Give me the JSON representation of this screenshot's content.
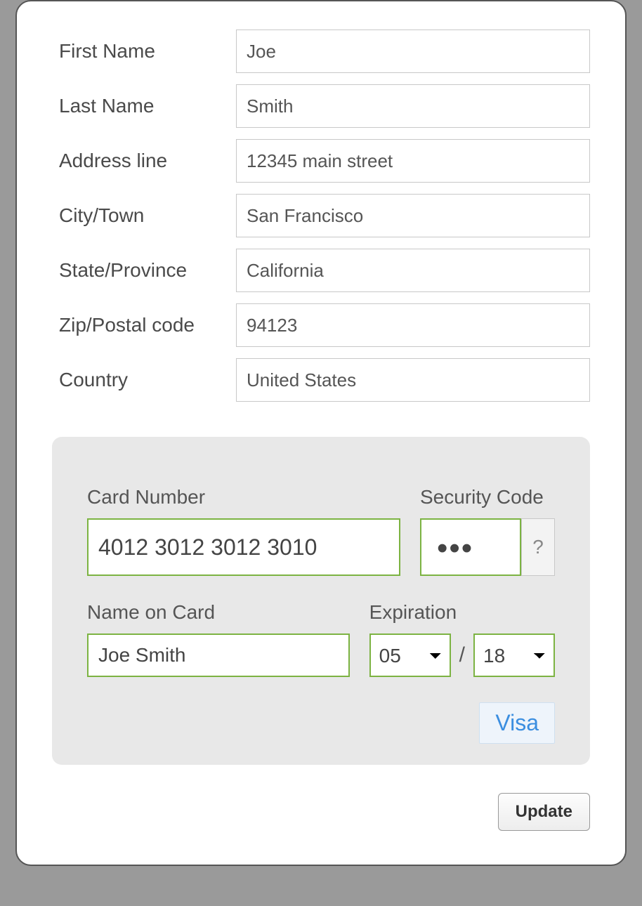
{
  "billing": {
    "first_name": {
      "label": "First Name",
      "value": "Joe"
    },
    "last_name": {
      "label": "Last Name",
      "value": "Smith"
    },
    "address": {
      "label": "Address line",
      "value": "12345 main street"
    },
    "city": {
      "label": "City/Town",
      "value": "San Francisco"
    },
    "state": {
      "label": "State/Province",
      "value": "California"
    },
    "zip": {
      "label": "Zip/Postal code",
      "value": "94123"
    },
    "country": {
      "label": "Country",
      "value": "United States"
    }
  },
  "payment": {
    "card_number": {
      "label": "Card Number",
      "value": "4012 3012 3012 3010"
    },
    "security_code": {
      "label": "Security Code",
      "value": "•••",
      "help": "?"
    },
    "name_on_card": {
      "label": "Name on Card",
      "value": "Joe Smith"
    },
    "expiration": {
      "label": "Expiration",
      "month": "05",
      "year": "18",
      "separator": "/"
    },
    "card_type": "Visa"
  },
  "actions": {
    "update": "Update"
  }
}
